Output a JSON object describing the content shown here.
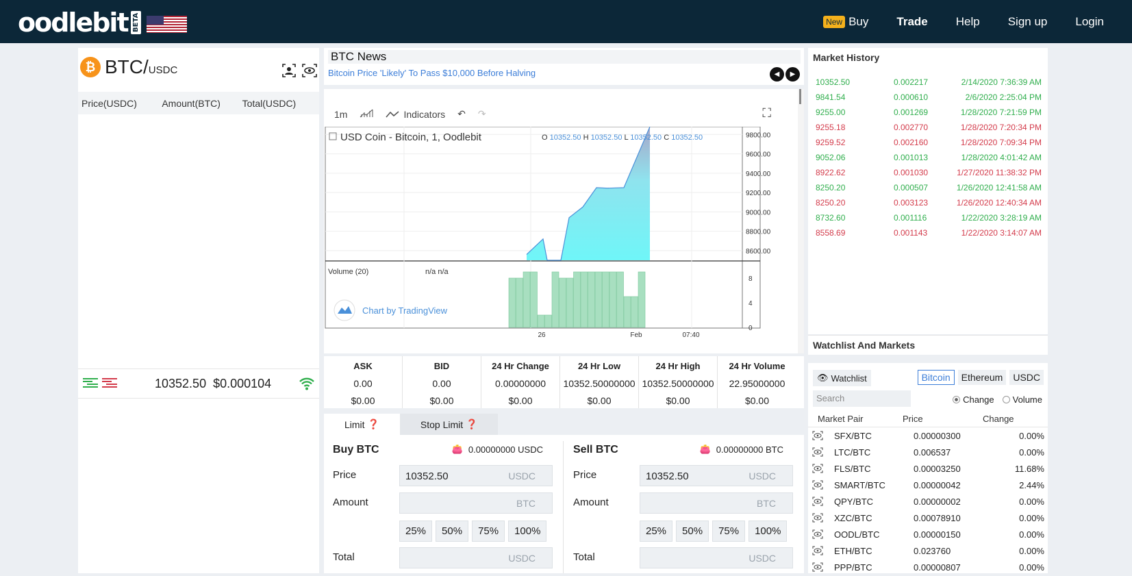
{
  "nav": {
    "brand": "oodlebit",
    "beta": "BETA",
    "new_badge": "New",
    "buy": "Buy",
    "trade": "Trade",
    "help": "Help",
    "signup": "Sign up",
    "login": "Login"
  },
  "pair": {
    "base": "BTC/",
    "quote": "USDC",
    "icon": "bitcoin-icon"
  },
  "orderbook": {
    "col_price": "Price(USDC)",
    "col_amount": "Amount(BTC)",
    "col_total": "Total(USDC)",
    "last_price": "10352.50",
    "last_usd": "$0.000104"
  },
  "news": {
    "title": "BTC News",
    "headline": "Bitcoin Price 'Likely' To Pass $10,000 Before Halving"
  },
  "chart": {
    "toolbar": {
      "interval": "1m",
      "indicators": "Indicators"
    },
    "symbol": "USD Coin - Bitcoin, 1, Oodlebit",
    "ohlc": {
      "o_label": "O",
      "o": "10352.50",
      "h_label": "H",
      "h": "10352.50",
      "l_label": "L",
      "l": "10352.50",
      "c_label": "C",
      "c": "10352.50"
    },
    "volume_label": "Volume (20)",
    "volume_vals": "n/a  n/a",
    "watermark": "Chart by TradingView",
    "price_ticks": [
      "9800.00",
      "9600.00",
      "9400.00",
      "9200.00",
      "9000.00",
      "8800.00",
      "8600.00"
    ],
    "volume_ticks": [
      "8",
      "4",
      "0"
    ],
    "x_ticks": [
      "26",
      "Feb",
      "07:40"
    ]
  },
  "chart_data": {
    "type": "area",
    "title": "USD Coin - Bitcoin, 1, Oodlebit",
    "ylim": [
      8500,
      9880
    ],
    "price_points": [
      [
        0,
        8560
      ],
      [
        1,
        8720
      ],
      [
        2,
        8500
      ],
      [
        3,
        8500
      ],
      [
        4,
        8940
      ],
      [
        5,
        9050
      ],
      [
        6,
        9250
      ],
      [
        7,
        9245
      ],
      [
        8,
        9250
      ],
      [
        9,
        9880
      ]
    ],
    "volume": [
      8,
      8,
      9,
      9,
      2,
      2,
      9,
      8,
      8,
      9,
      9,
      9,
      9,
      9,
      9,
      9,
      5,
      5,
      9
    ],
    "volume_ylim": [
      0,
      10
    ]
  },
  "quotes": [
    {
      "h": "ASK",
      "v": "0.00",
      "u": "$0.00"
    },
    {
      "h": "BID",
      "v": "0.00",
      "u": "$0.00"
    },
    {
      "h": "24 Hr Change",
      "v": "0.00000000",
      "u": "$0.00"
    },
    {
      "h": "24 Hr Low",
      "v": "10352.50000000",
      "u": "$0.00"
    },
    {
      "h": "24 Hr High",
      "v": "10352.50000000",
      "u": "$0.00"
    },
    {
      "h": "24 Hr Volume",
      "v": "22.95000000",
      "u": "$0.00"
    }
  ],
  "trade": {
    "tab_limit": "Limit",
    "tab_stop": "Stop Limit",
    "buy": {
      "title": "Buy BTC",
      "balance": "0.00000000 USDC",
      "price_label": "Price",
      "price": "10352.50",
      "price_unit": "USDC",
      "amount_label": "Amount",
      "amount_unit": "BTC",
      "total_label": "Total",
      "total_unit": "USDC"
    },
    "sell": {
      "title": "Sell BTC",
      "balance": "0.00000000 BTC",
      "price_label": "Price",
      "price": "10352.50",
      "price_unit": "USDC",
      "amount_label": "Amount",
      "amount_unit": "BTC",
      "total_label": "Total",
      "total_unit": "USDC"
    },
    "pcts": [
      "25%",
      "50%",
      "75%",
      "100%"
    ]
  },
  "market_history": {
    "title": "Market History",
    "rows": [
      {
        "price": "10352.50",
        "amount": "0.002217",
        "time": "2/14/2020 7:36:39 AM",
        "side": "buy"
      },
      {
        "price": "9841.54",
        "amount": "0.000610",
        "time": "2/6/2020 2:25:04 PM",
        "side": "buy"
      },
      {
        "price": "9255.00",
        "amount": "0.001269",
        "time": "1/28/2020 7:21:59 PM",
        "side": "buy"
      },
      {
        "price": "9255.18",
        "amount": "0.002770",
        "time": "1/28/2020 7:20:34 PM",
        "side": "sell"
      },
      {
        "price": "9259.52",
        "amount": "0.002160",
        "time": "1/28/2020 7:09:34 PM",
        "side": "sell"
      },
      {
        "price": "9052.06",
        "amount": "0.001013",
        "time": "1/28/2020 4:01:42 AM",
        "side": "buy"
      },
      {
        "price": "8922.62",
        "amount": "0.001030",
        "time": "1/27/2020 11:38:32 PM",
        "side": "sell"
      },
      {
        "price": "8250.20",
        "amount": "0.000507",
        "time": "1/26/2020 12:41:58 AM",
        "side": "buy"
      },
      {
        "price": "8250.20",
        "amount": "0.003123",
        "time": "1/26/2020 12:40:34 AM",
        "side": "sell"
      },
      {
        "price": "8732.60",
        "amount": "0.001116",
        "time": "1/22/2020 3:28:19 AM",
        "side": "buy"
      },
      {
        "price": "8558.69",
        "amount": "0.001143",
        "time": "1/22/2020 3:14:07 AM",
        "side": "sell"
      }
    ]
  },
  "watchlist": {
    "title": "Watchlist And Markets",
    "button": "Watchlist",
    "coins": [
      "Bitcoin",
      "Ethereum",
      "USDC"
    ],
    "search_placeholder": "Search",
    "radio_change": "Change",
    "radio_volume": "Volume",
    "col_pair": "Market Pair",
    "col_price": "Price",
    "col_change": "Change",
    "rows": [
      {
        "pair": "SFX/BTC",
        "price": "0.00000300",
        "change": "0.00%"
      },
      {
        "pair": "LTC/BTC",
        "price": "0.006537",
        "change": "0.00%"
      },
      {
        "pair": "FLS/BTC",
        "price": "0.00003250",
        "change": "11.68%"
      },
      {
        "pair": "SMART/BTC",
        "price": "0.00000042",
        "change": "2.44%"
      },
      {
        "pair": "QPY/BTC",
        "price": "0.00000002",
        "change": "0.00%"
      },
      {
        "pair": "XZC/BTC",
        "price": "0.00078910",
        "change": "0.00%"
      },
      {
        "pair": "OODL/BTC",
        "price": "0.00000150",
        "change": "0.00%"
      },
      {
        "pair": "ETH/BTC",
        "price": "0.023760",
        "change": "0.00%"
      },
      {
        "pair": "PPP/BTC",
        "price": "0.00000807",
        "change": "0.00%"
      }
    ]
  },
  "colors": {
    "nav_bg": "#0c2738",
    "buy": "#2fae4c",
    "sell": "#d33a4a",
    "link": "#3b7dd8"
  }
}
